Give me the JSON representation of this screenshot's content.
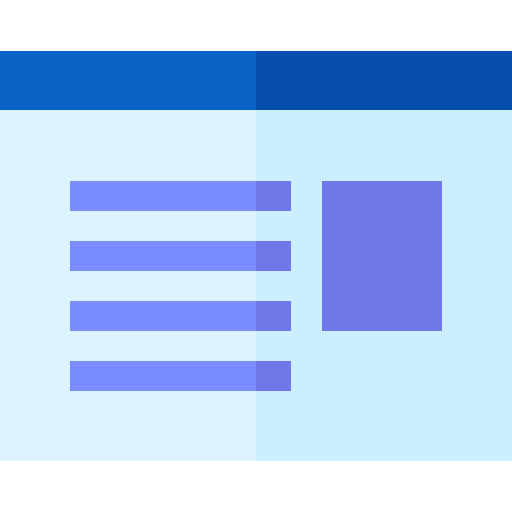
{
  "icon": {
    "name": "webpage-layout-icon",
    "colors": {
      "header_left": "#0A64C8",
      "header_right": "#084EAC",
      "body_left": "#DAF3FE",
      "body_right": "#CCEEFF",
      "line_light": "#7A8CFF",
      "line_dark": "#6E78E6",
      "image_block": "#6E78E6"
    }
  }
}
